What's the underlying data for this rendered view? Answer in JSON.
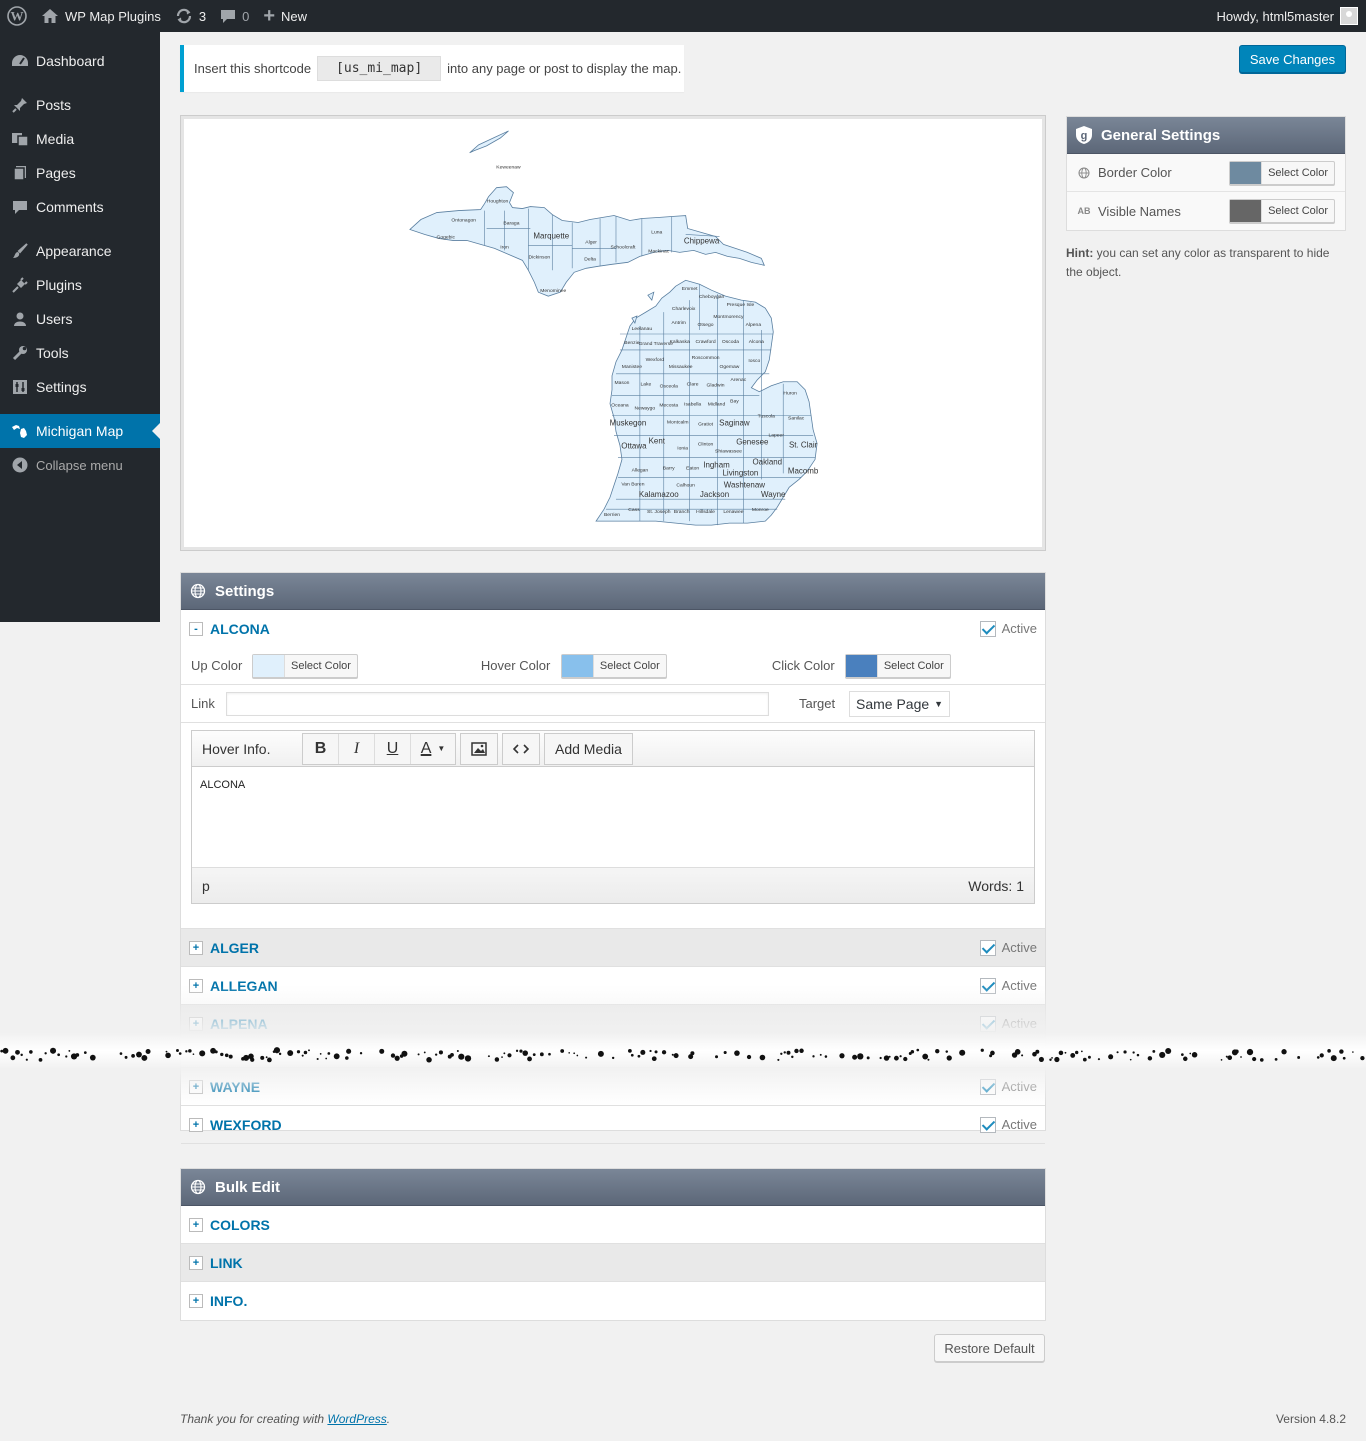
{
  "adminbar": {
    "site_name": "WP Map Plugins",
    "updates_count": "3",
    "comments_count": "0",
    "new_label": "New",
    "howdy": "Howdy, html5master"
  },
  "sidebar": {
    "items": [
      {
        "label": "Dashboard",
        "icon": "dashboard-icon"
      },
      {
        "label": "Posts",
        "icon": "pin-icon"
      },
      {
        "label": "Media",
        "icon": "media-icon"
      },
      {
        "label": "Pages",
        "icon": "pages-icon"
      },
      {
        "label": "Comments",
        "icon": "comment-icon"
      },
      {
        "label": "Appearance",
        "icon": "brush-icon"
      },
      {
        "label": "Plugins",
        "icon": "plug-icon"
      },
      {
        "label": "Users",
        "icon": "user-icon"
      },
      {
        "label": "Tools",
        "icon": "wrench-icon"
      },
      {
        "label": "Settings",
        "icon": "sliders-icon"
      },
      {
        "label": "Michigan Map",
        "icon": "map-icon"
      }
    ],
    "collapse_label": "Collapse menu"
  },
  "notice": {
    "before": "Insert this shortcode",
    "shortcode": "[us_mi_map]",
    "after": "into any page or post to display the map."
  },
  "save_button": "Save Changes",
  "map": {
    "fill": "#e0f0fc",
    "border": "#5a7fa0",
    "counties": [
      "Keweenaw",
      "Houghton",
      "Ontonagon",
      "Gogebic",
      "Baraga",
      "Iron",
      "Marquette",
      "Dickinson",
      "Alger",
      "Delta",
      "Schoolcraft",
      "Menominee",
      "Luna",
      "Mackinac",
      "Chippewa",
      "Emmet",
      "Cheboygan",
      "Presque Isle",
      "Charlevoix",
      "Montmorency",
      "Antrim",
      "Otsego",
      "Alpena",
      "Leelanau",
      "Grand Traverse",
      "Kalkaska",
      "Crawford",
      "Oscoda",
      "Alcona",
      "Benzie",
      "Wexford",
      "Roscommon",
      "Manistee",
      "Missaukee",
      "Ogemaw",
      "Iosco",
      "Arenac",
      "Mason",
      "Lake",
      "Osceola",
      "Clare",
      "Gladwin",
      "Huron",
      "Bay",
      "Oceana",
      "Newaygo",
      "Mecosta",
      "Isabella",
      "Midland",
      "Tuscola",
      "Sanilac",
      "Muskegon",
      "Montcalm",
      "Gratiot",
      "Saginaw",
      "Lapeer",
      "St. Clair",
      "Ottawa",
      "Kent",
      "Ionia",
      "Clinton",
      "Shiawassee",
      "Genesee",
      "Oakland",
      "Macomb",
      "Allegan",
      "Barry",
      "Eaton",
      "Ingham",
      "Livingston",
      "Van Buren",
      "Kalamazoo",
      "Calhoun",
      "Jackson",
      "Washtenaw",
      "Wayne",
      "Berrien",
      "Cass",
      "St. Joseph",
      "Branch",
      "Hillsdale",
      "Lenawee",
      "Monroe"
    ]
  },
  "settings_panel": {
    "title": "Settings",
    "expanded_region": {
      "name": "ALCONA",
      "active_label": "Active",
      "up_color_label": "Up Color",
      "up_color": "#e0f0fc",
      "hover_color_label": "Hover Color",
      "hover_color": "#88c0ec",
      "click_color_label": "Click Color",
      "click_color": "#4a80be",
      "select_color": "Select Color",
      "link_label": "Link",
      "link_value": "",
      "target_label": "Target",
      "target_value": "Same Page",
      "hover_info_label": "Hover Info.",
      "add_media": "Add Media",
      "content": "ALCONA",
      "path": "p",
      "words": "Words: 1"
    },
    "regions": [
      {
        "name": "ALGER",
        "active_label": "Active"
      },
      {
        "name": "ALLEGAN",
        "active_label": "Active"
      },
      {
        "name": "ALPENA",
        "active_label": "Active"
      },
      {
        "name": "WAYNE",
        "active_label": "Active"
      },
      {
        "name": "WEXFORD",
        "active_label": "Active"
      }
    ]
  },
  "bulk_edit": {
    "title": "Bulk Edit",
    "items": [
      "COLORS",
      "LINK",
      "INFO."
    ]
  },
  "restore_button": "Restore Default",
  "general_settings": {
    "title": "General Settings",
    "rows": [
      {
        "label": "Border Color",
        "color": "#6e8aa0",
        "button": "Select Color",
        "icon": "globe-icon"
      },
      {
        "label": "Visible Names",
        "color": "#666666",
        "button": "Select Color",
        "icon": "ab-icon"
      }
    ],
    "hint_bold": "Hint:",
    "hint_text": "you can set any color as transparent to hide the object."
  },
  "footer": {
    "thanks_prefix": "Thank you for creating with",
    "thanks_link": "WordPress",
    "thanks_suffix": ".",
    "version": "Version 4.8.2"
  }
}
